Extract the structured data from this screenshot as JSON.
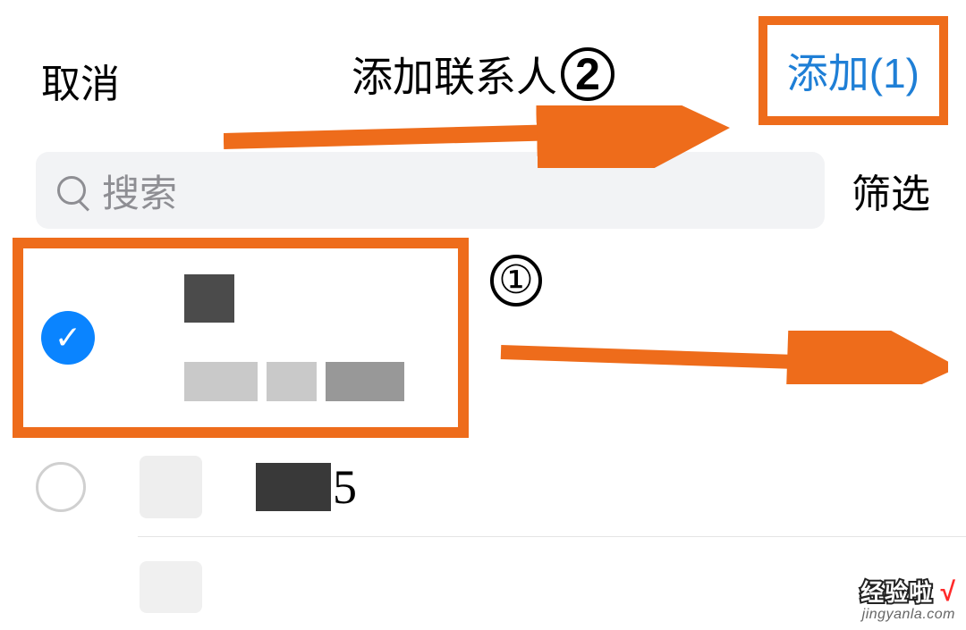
{
  "header": {
    "cancel": "取消",
    "title": "添加联系人",
    "add_label": "添加",
    "add_count": "(1)"
  },
  "annotations": {
    "step1": "①",
    "step2": "2",
    "highlight_color": "#ee6c1b"
  },
  "search": {
    "placeholder": "搜索",
    "filter_label": "筛选"
  },
  "contacts": {
    "row1": {
      "checked": true
    },
    "row2": {
      "checked": false,
      "suffix": "5"
    }
  },
  "watermark": {
    "brand": "经验啦",
    "check": "√",
    "url": "jingyanla.com"
  }
}
